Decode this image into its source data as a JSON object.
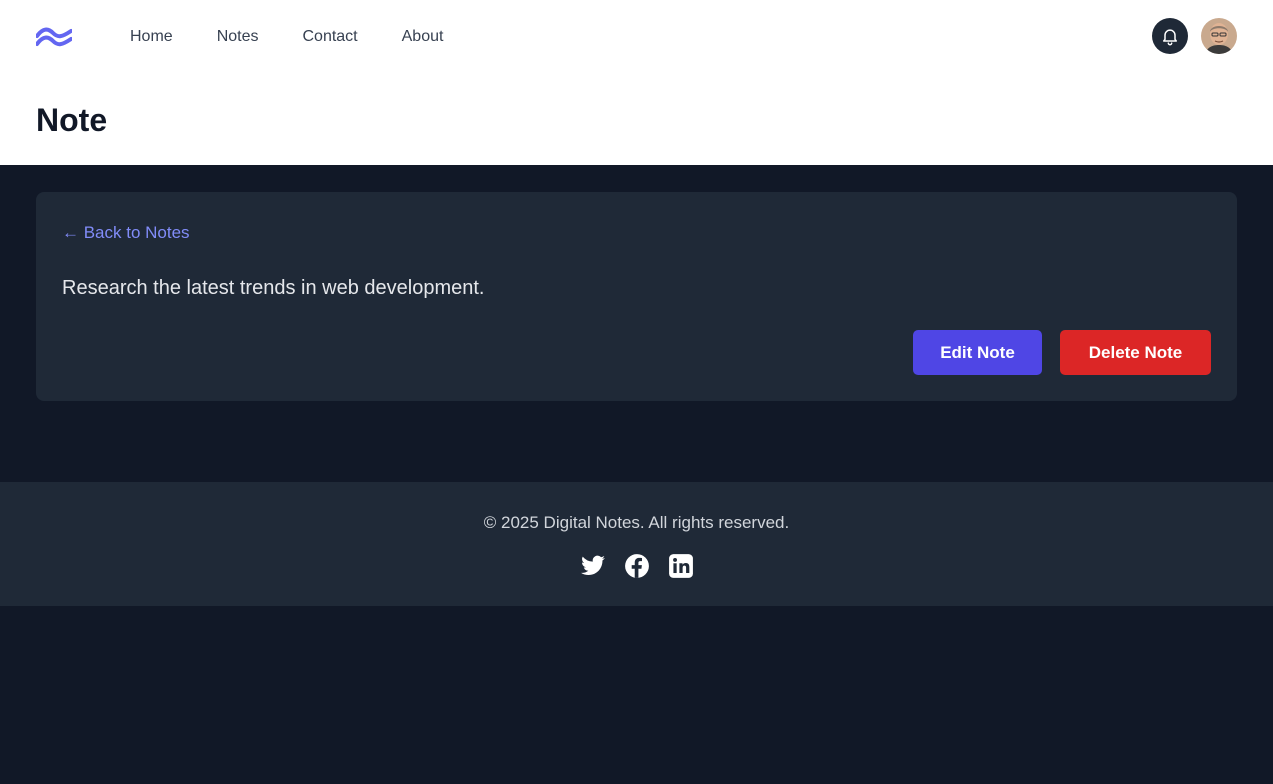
{
  "nav": {
    "items": [
      {
        "label": "Home"
      },
      {
        "label": "Notes"
      },
      {
        "label": "Contact"
      },
      {
        "label": "About"
      }
    ],
    "icons": {
      "logo": "wave-logo",
      "notifications": "bell-icon",
      "user": "avatar"
    }
  },
  "page": {
    "title": "Note"
  },
  "note": {
    "back_label": "← Back to Notes",
    "content": "Research the latest trends in web development.",
    "edit_label": "Edit Note",
    "delete_label": "Delete Note"
  },
  "footer": {
    "copyright": "© 2025 Digital Notes. All rights reserved.",
    "socials": [
      "twitter-icon",
      "facebook-icon",
      "linkedin-icon"
    ]
  },
  "colors": {
    "accent": "#4f46e5",
    "link": "#818cf8",
    "danger": "#dc2626",
    "page_bg": "#111827",
    "card_bg": "#1f2937"
  }
}
